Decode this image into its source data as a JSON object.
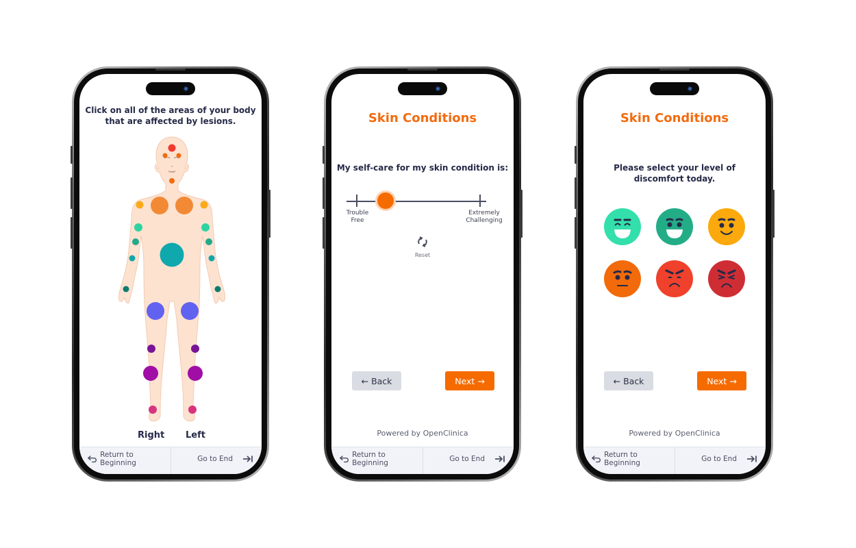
{
  "screens": [
    {
      "id": "body-map",
      "question": [
        "Click on all of the areas of your body",
        "that are affected by lesions."
      ],
      "side_labels": {
        "right": "Right",
        "left": "Left"
      },
      "body_spots": [
        {
          "region": "forehead",
          "color": "#ef3b2d"
        },
        {
          "region": "right-eye",
          "color": "#f26b0f"
        },
        {
          "region": "left-eye",
          "color": "#f26b0f"
        },
        {
          "region": "neck",
          "color": "#f26b0f"
        },
        {
          "region": "right-shoulder",
          "color": "#fbaa1a"
        },
        {
          "region": "left-shoulder",
          "color": "#fbaa1a"
        },
        {
          "region": "right-chest",
          "color": "#f28a35"
        },
        {
          "region": "left-chest",
          "color": "#f28a35"
        },
        {
          "region": "right-upper-arm",
          "color": "#2fd3a1"
        },
        {
          "region": "left-upper-arm",
          "color": "#2fd3a1"
        },
        {
          "region": "right-elbow",
          "color": "#22a98a"
        },
        {
          "region": "left-elbow",
          "color": "#22a98a"
        },
        {
          "region": "right-forearm",
          "color": "#14a5a8"
        },
        {
          "region": "left-forearm",
          "color": "#14a5a8"
        },
        {
          "region": "abdomen",
          "color": "#0fa8ad"
        },
        {
          "region": "right-hand",
          "color": "#0f7c70"
        },
        {
          "region": "left-hand",
          "color": "#0f7c70"
        },
        {
          "region": "right-thigh",
          "color": "#6262f0"
        },
        {
          "region": "left-thigh",
          "color": "#6262f0"
        },
        {
          "region": "right-knee",
          "color": "#7a1496"
        },
        {
          "region": "left-knee",
          "color": "#7a1496"
        },
        {
          "region": "right-shin",
          "color": "#a00ea6"
        },
        {
          "region": "left-shin",
          "color": "#a00ea6"
        },
        {
          "region": "right-ankle",
          "color": "#d9337e"
        },
        {
          "region": "left-ankle",
          "color": "#d9337e"
        }
      ]
    },
    {
      "id": "self-care",
      "title": "Skin Conditions",
      "question": "My self-care for my skin condition is:",
      "slider": {
        "min_label": [
          "Trouble",
          "Free"
        ],
        "max_label": [
          "Extremely",
          "Challenging"
        ],
        "value_fraction": 0.24
      },
      "reset_label": "Reset",
      "back_label": "Back",
      "next_label": "Next",
      "powered_by": "Powered by OpenClinica"
    },
    {
      "id": "discomfort",
      "title": "Skin Conditions",
      "question": [
        "Please select your level of",
        "discomfort today."
      ],
      "faces": [
        {
          "level": "very-happy",
          "color": "#33dfab"
        },
        {
          "level": "happy",
          "color": "#23ad87"
        },
        {
          "level": "content",
          "color": "#fba90d"
        },
        {
          "level": "neutral",
          "color": "#f26a0a"
        },
        {
          "level": "upset",
          "color": "#f0412c"
        },
        {
          "level": "very-upset",
          "color": "#cf2d34"
        }
      ],
      "back_label": "Back",
      "next_label": "Next",
      "powered_by": "Powered by OpenClinica"
    }
  ],
  "footer": {
    "return_label": "Return to Beginning",
    "end_label": "Go to End"
  },
  "colors": {
    "accent": "#f56b00",
    "title": "#f26b0f",
    "text": "#262a48",
    "skin": "#fde2d0"
  }
}
